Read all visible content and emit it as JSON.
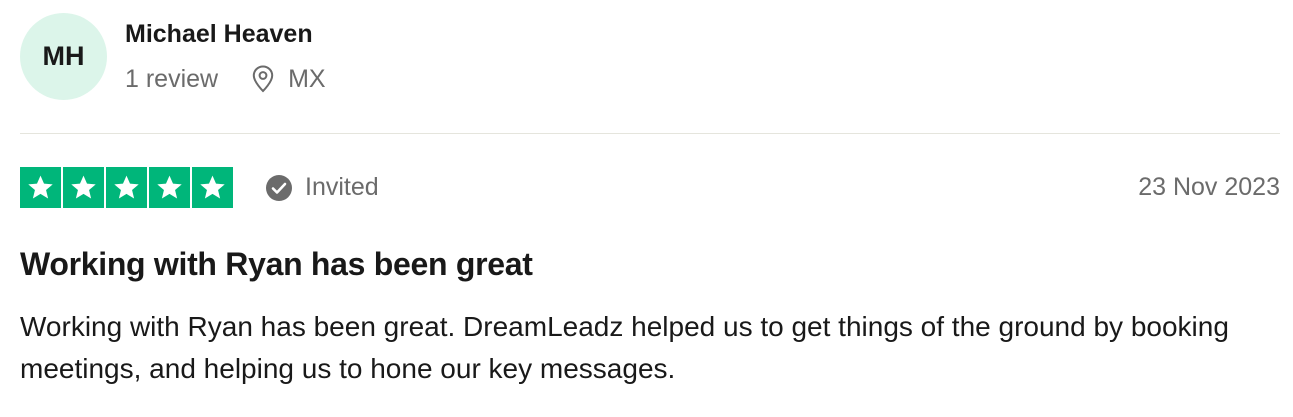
{
  "consumer": {
    "initials": "MH",
    "name": "Michael Heaven",
    "review_count": "1 review",
    "location": "MX",
    "location_icon": "location-pin-icon"
  },
  "review": {
    "rating": 5,
    "rating_max": 5,
    "star_color": "#00b67a",
    "status_label": "Invited",
    "status_icon": "check-circle-icon",
    "date": "23 Nov 2023",
    "title": "Working with Ryan has been great",
    "text": "Working with Ryan has been great. DreamLeadz helped us to get things of the ground by booking meetings, and helping us to hone our key messages."
  }
}
